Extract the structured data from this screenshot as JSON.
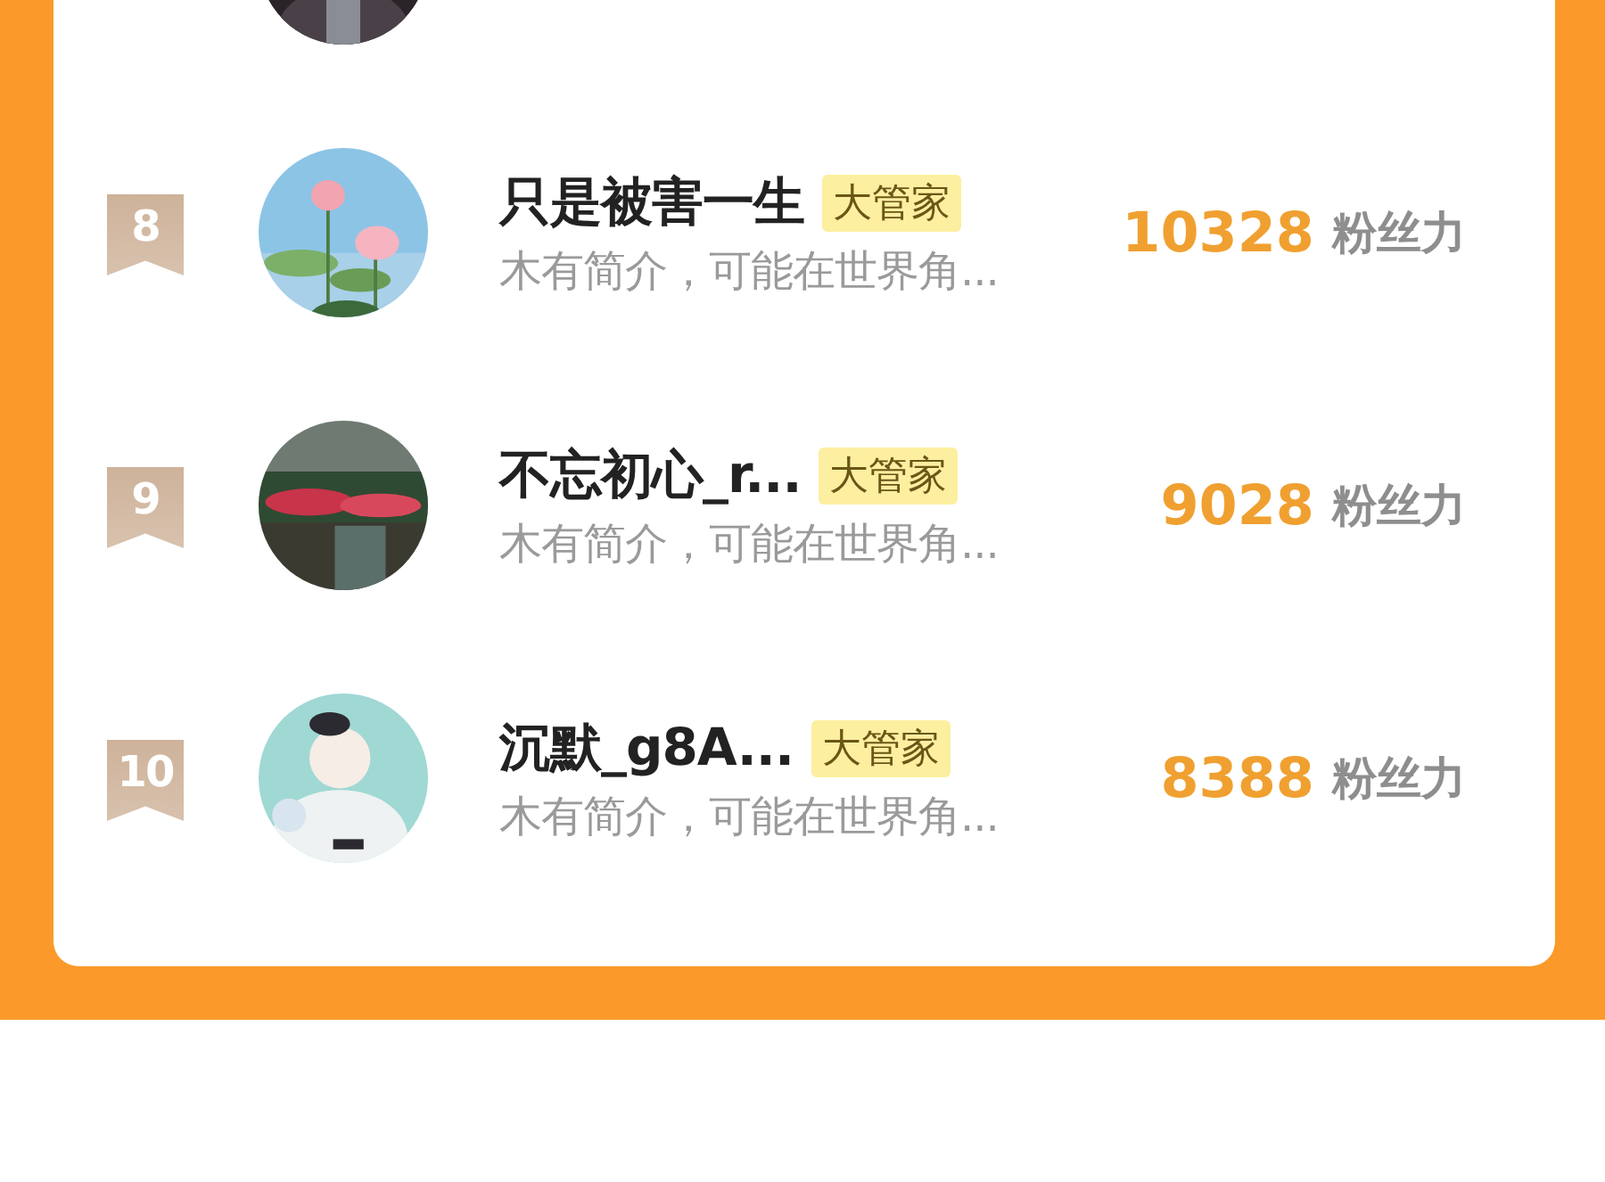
{
  "rows": [
    {
      "rank": "8",
      "name": "只是被害一生",
      "tag": "大管家",
      "bio": "木有简介，可能在世界角...",
      "score": "10328",
      "score_unit": "粉丝力"
    },
    {
      "rank": "9",
      "name": "不忘初心_r...",
      "tag": "大管家",
      "bio": "木有简介，可能在世界角...",
      "score": "9028",
      "score_unit": "粉丝力"
    },
    {
      "rank": "10",
      "name": "沉默_g8A...",
      "tag": "大管家",
      "bio": "木有简介，可能在世界角...",
      "score": "8388",
      "score_unit": "粉丝力"
    }
  ]
}
